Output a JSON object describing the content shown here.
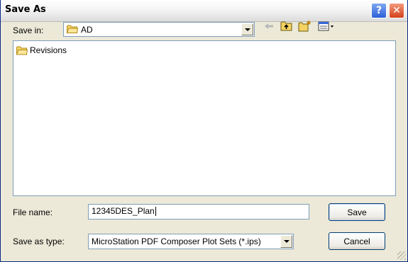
{
  "window": {
    "title": "Save As"
  },
  "title_buttons": {
    "help": "?",
    "close": "✕"
  },
  "save_in": {
    "label": "Save in:",
    "value": "AD"
  },
  "toolbar": {
    "back_icon": "back-arrow-icon",
    "up_icon": "up-folder-icon",
    "new_folder_icon": "new-folder-icon",
    "view_menu_icon": "view-menu-icon"
  },
  "file_list": {
    "items": [
      {
        "label": "Revisions",
        "icon": "folder-icon"
      }
    ]
  },
  "file_name": {
    "label": "File name:",
    "value": "12345DES_Plan"
  },
  "save_type": {
    "label": "Save as type:",
    "value": "MicroStation PDF Composer Plot Sets (*.ips)"
  },
  "buttons": {
    "save": "Save",
    "cancel": "Cancel"
  },
  "colors": {
    "dialog_bg": "#ece9d8",
    "folder_yellow": "#f5d362",
    "field_border": "#7f9db9"
  }
}
